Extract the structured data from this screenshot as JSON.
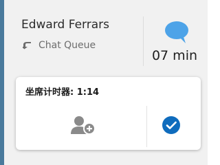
{
  "contact": {
    "name": "Edward Ferrars",
    "queue_label": "Chat Queue",
    "queue_icon": "arrow-turn-down-icon",
    "channel_icon": "chat-bubble-icon",
    "wait_time": "07 min"
  },
  "panel": {
    "timer_text": "坐席计时器: 1:14",
    "add_contact_icon": "add-contact-icon",
    "accept_icon": "check-circle-icon"
  },
  "colors": {
    "accent_border": "#4a7a9c",
    "chat_icon": "#4da3e8",
    "accept_button": "#0f6cbd",
    "contact_icon": "#8a8a8a"
  }
}
